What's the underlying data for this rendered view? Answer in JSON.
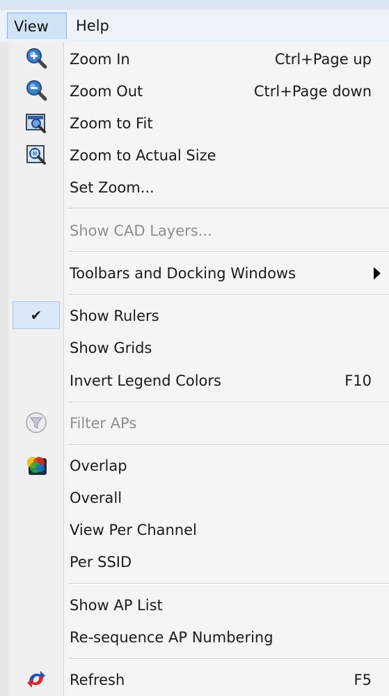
{
  "menubar": {
    "items": [
      "View",
      "Help"
    ]
  },
  "menu": {
    "items": [
      {
        "label": "Zoom In",
        "shortcut": "Ctrl+Page up",
        "icon": "zoom-in-icon"
      },
      {
        "label": "Zoom Out",
        "shortcut": "Ctrl+Page down",
        "icon": "zoom-out-icon"
      },
      {
        "label": "Zoom to Fit",
        "shortcut": "",
        "icon": "zoom-to-fit-icon"
      },
      {
        "label": "Zoom to Actual Size",
        "shortcut": "",
        "icon": "zoom-actual-size-icon"
      },
      {
        "label": "Set Zoom...",
        "shortcut": ""
      },
      {
        "label": "Show CAD Layers...",
        "shortcut": "",
        "disabled": true
      },
      {
        "label": "Toolbars and Docking Windows",
        "shortcut": "",
        "submenu": true
      },
      {
        "label": "Show Rulers",
        "shortcut": "",
        "checked": true,
        "check_glyph": "✔"
      },
      {
        "label": "Show Grids",
        "shortcut": ""
      },
      {
        "label": "Invert Legend Colors",
        "shortcut": "F10"
      },
      {
        "label": "Filter APs",
        "shortcut": "",
        "disabled": true,
        "icon": "filter-icon"
      },
      {
        "label": "Overlap",
        "shortcut": "",
        "icon": "overlap-icon"
      },
      {
        "label": "Overall",
        "shortcut": ""
      },
      {
        "label": "View Per Channel",
        "shortcut": ""
      },
      {
        "label": "Per SSID",
        "shortcut": ""
      },
      {
        "label": "Show AP List",
        "shortcut": ""
      },
      {
        "label": "Re-sequence AP Numbering",
        "shortcut": ""
      },
      {
        "label": "Refresh",
        "shortcut": "F5",
        "icon": "refresh-icon"
      }
    ]
  },
  "colors": {
    "menu_bg": "#f5f5f5",
    "gutter_bg": "#f0f0f0",
    "highlight": "#dbe8f7",
    "disabled_text": "#8e8e8e",
    "text": "#1a1a1a"
  }
}
